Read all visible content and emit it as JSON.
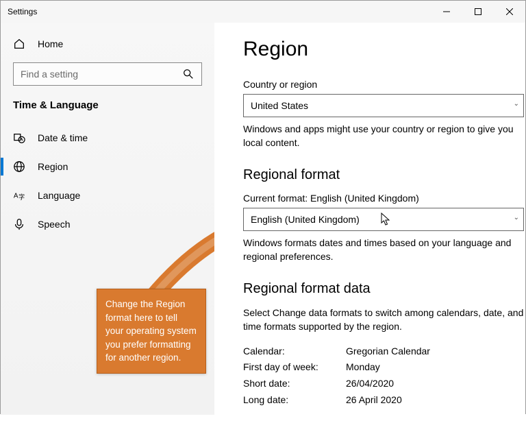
{
  "window": {
    "title": "Settings"
  },
  "sidebar": {
    "home": "Home",
    "search_placeholder": "Find a setting",
    "section": "Time & Language",
    "items": [
      {
        "label": "Date & time"
      },
      {
        "label": "Region"
      },
      {
        "label": "Language"
      },
      {
        "label": "Speech"
      }
    ]
  },
  "callout": {
    "text": "Change the Region format here to tell your operating system you prefer formatting for another region."
  },
  "main": {
    "title": "Region",
    "country_label": "Country or region",
    "country_value": "United States",
    "country_hint": "Windows and apps might use your country or region to give you local content.",
    "format_heading": "Regional format",
    "current_format_label": "Current format: English (United Kingdom)",
    "format_value": "English (United Kingdom)",
    "format_hint": "Windows formats dates and times based on your language and regional preferences.",
    "data_heading": "Regional format data",
    "data_hint": "Select Change data formats to switch among calendars, date, and time formats supported by the region.",
    "rows": {
      "calendar_k": "Calendar:",
      "calendar_v": "Gregorian Calendar",
      "firstday_k": "First day of week:",
      "firstday_v": "Monday",
      "shortdate_k": "Short date:",
      "shortdate_v": "26/04/2020",
      "longdate_k": "Long date:",
      "longdate_v": "26 April 2020"
    }
  }
}
